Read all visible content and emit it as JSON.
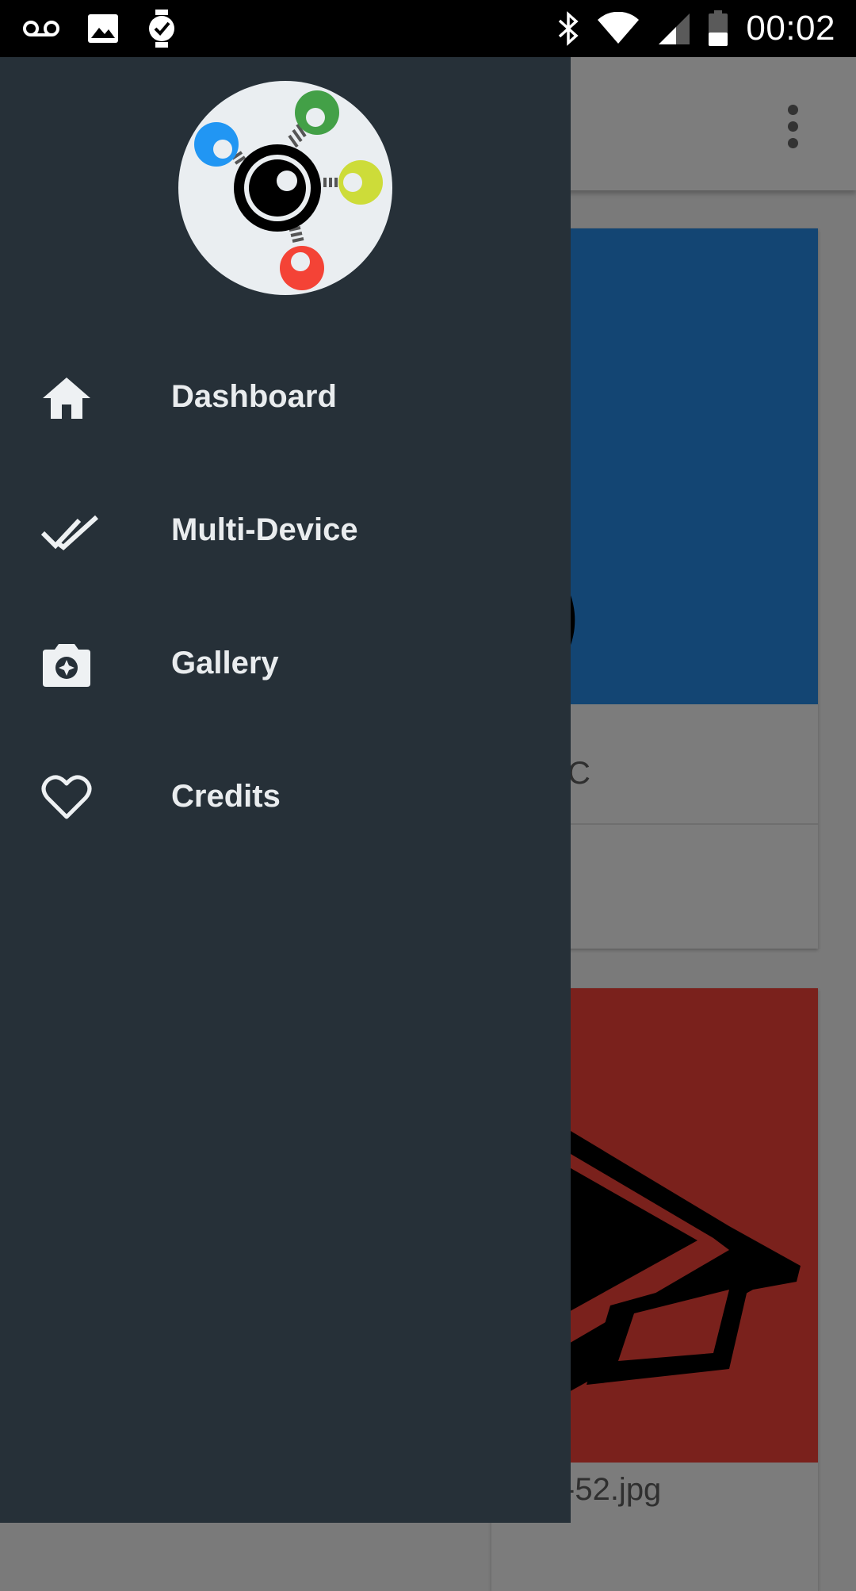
{
  "status_bar": {
    "time": "00:02",
    "left_icons": [
      "voicemail-icon",
      "image-icon",
      "watch-icon"
    ],
    "right_icons": [
      "bluetooth-icon",
      "wifi-icon",
      "cell-signal-icon",
      "battery-icon"
    ]
  },
  "drawer": {
    "background_color": "#263038",
    "items": [
      {
        "label": "Dashboard",
        "icon": "home-icon"
      },
      {
        "label": "Multi-Device",
        "icon": "double-check-icon"
      },
      {
        "label": "Gallery",
        "icon": "camera-icon"
      },
      {
        "label": "Credits",
        "icon": "heart-icon"
      }
    ]
  },
  "background": {
    "card1": {
      "caption": "°C",
      "media_color": "#134573"
    },
    "card2": {
      "caption": "-52.jpg",
      "media_color": "#7a211c"
    }
  }
}
